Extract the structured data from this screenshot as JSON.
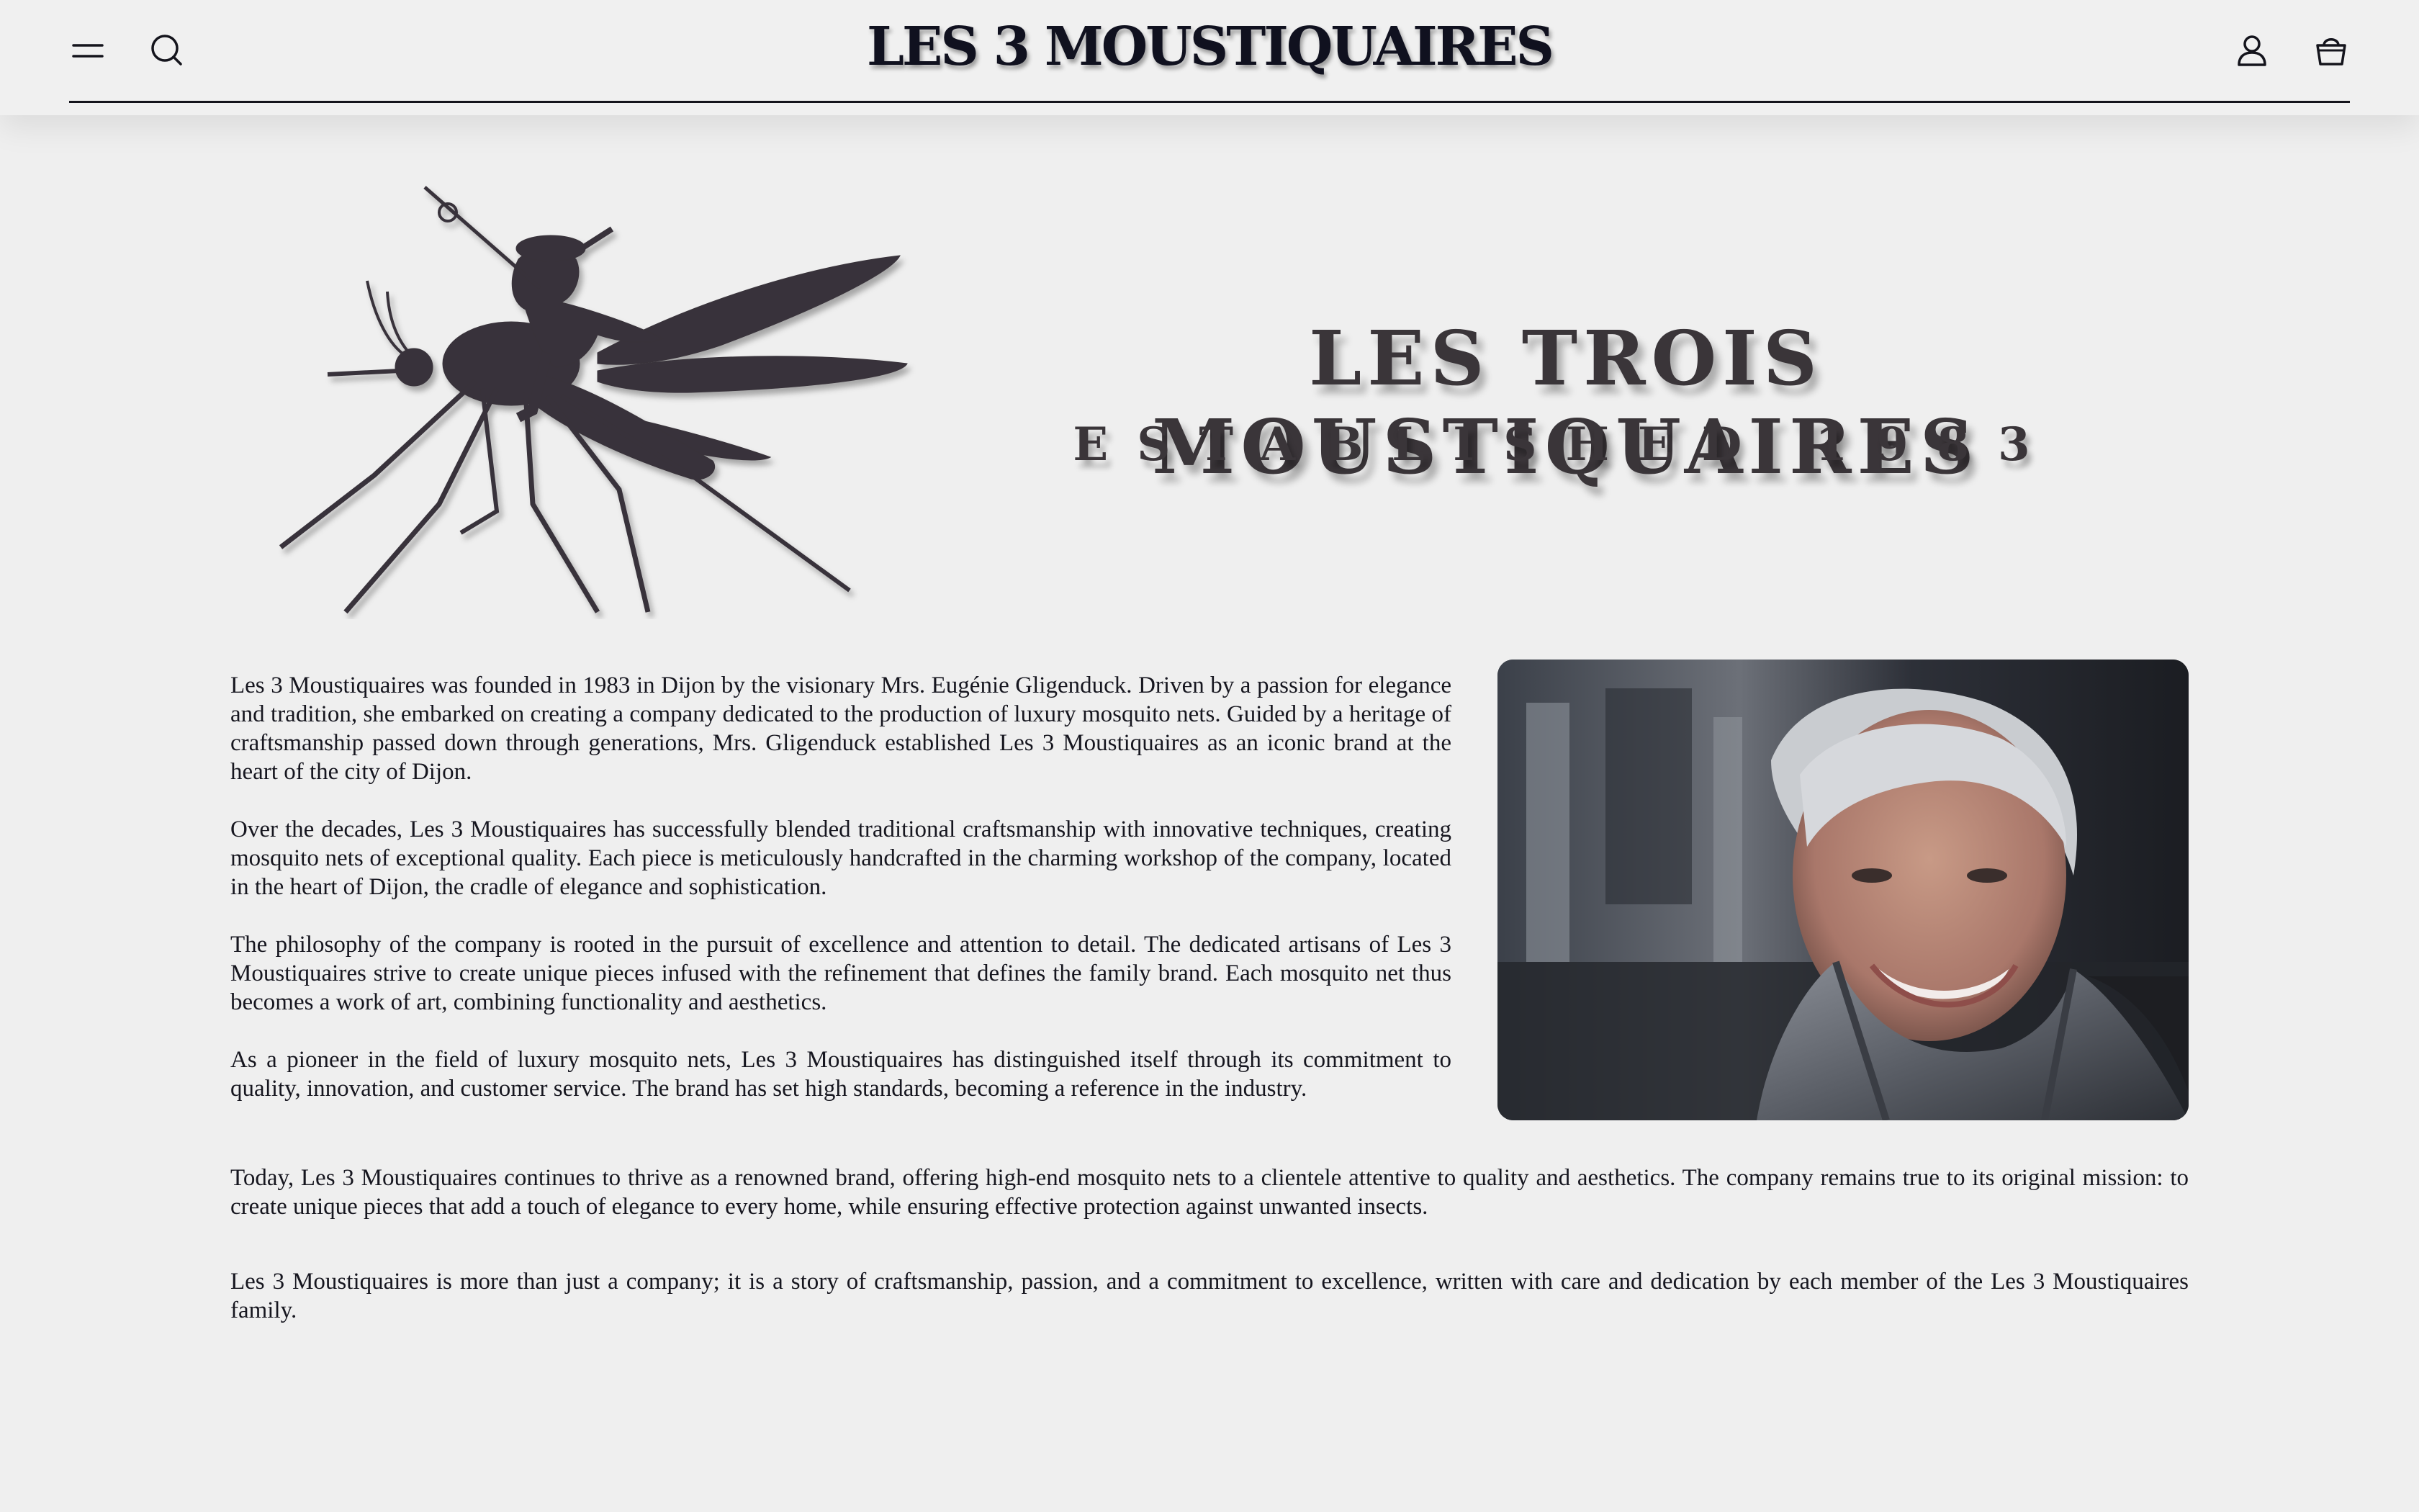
{
  "header": {
    "brand": "LES 3 MOUSTIQUAIRES",
    "icons": {
      "menu": "menu-icon",
      "search": "search-icon",
      "account": "user-icon",
      "cart": "basket-icon"
    }
  },
  "hero": {
    "title": "LES TROIS MOUSTIQUAIRES",
    "subtitle": "ESTABLISHED 1983"
  },
  "content": {
    "paragraphs": [
      "Les 3 Moustiquaires was founded in 1983 in Dijon by the visionary Mrs. Eugénie Gligenduck. Driven by a passion for elegance and tradition, she embarked on creating a company dedicated to the production of luxury mosquito nets. Guided by a heritage of craftsmanship passed down through generations, Mrs. Gligenduck established Les 3 Moustiquaires as an iconic brand at the heart of the city of Dijon.",
      "Over the decades, Les 3 Moustiquaires has successfully blended traditional craftsmanship with innovative techniques, creating mosquito nets of exceptional quality. Each piece is meticulously handcrafted in the charming workshop of the company, located in the heart of Dijon, the cradle of elegance and sophistication.",
      "The philosophy of the company is rooted in the pursuit of excellence and attention to detail. The dedicated artisans of Les 3 Moustiquaires strive to create unique pieces infused with the refinement that defines the family brand. Each mosquito net thus becomes a work of art, combining functionality and aesthetics.",
      "As a pioneer in the field of luxury mosquito nets, Les 3 Moustiquaires has distinguished itself through its commitment to quality, innovation, and customer service. The brand has set high standards, becoming a reference in the industry.",
      "Today, Les 3 Moustiquaires continues to thrive as a renowned brand, offering high-end mosquito nets to a clientele attentive to quality and aesthetics. The company remains true to its original mission: to create unique pieces that add a touch of elegance to every home, while ensuring effective protection against unwanted insects.",
      "Les 3 Moustiquaires is more than just a company; it is a story of craftsmanship, passion, and a commitment to excellence, written with care and dedication by each member of the Les 3 Moustiquaires family."
    ]
  },
  "images": {
    "logo": "mosquito-musketeer-illustration",
    "portrait": "founder-portrait-photo"
  },
  "colors": {
    "background": "#efefef",
    "text": "#14141c",
    "heading": "#3a3539"
  }
}
